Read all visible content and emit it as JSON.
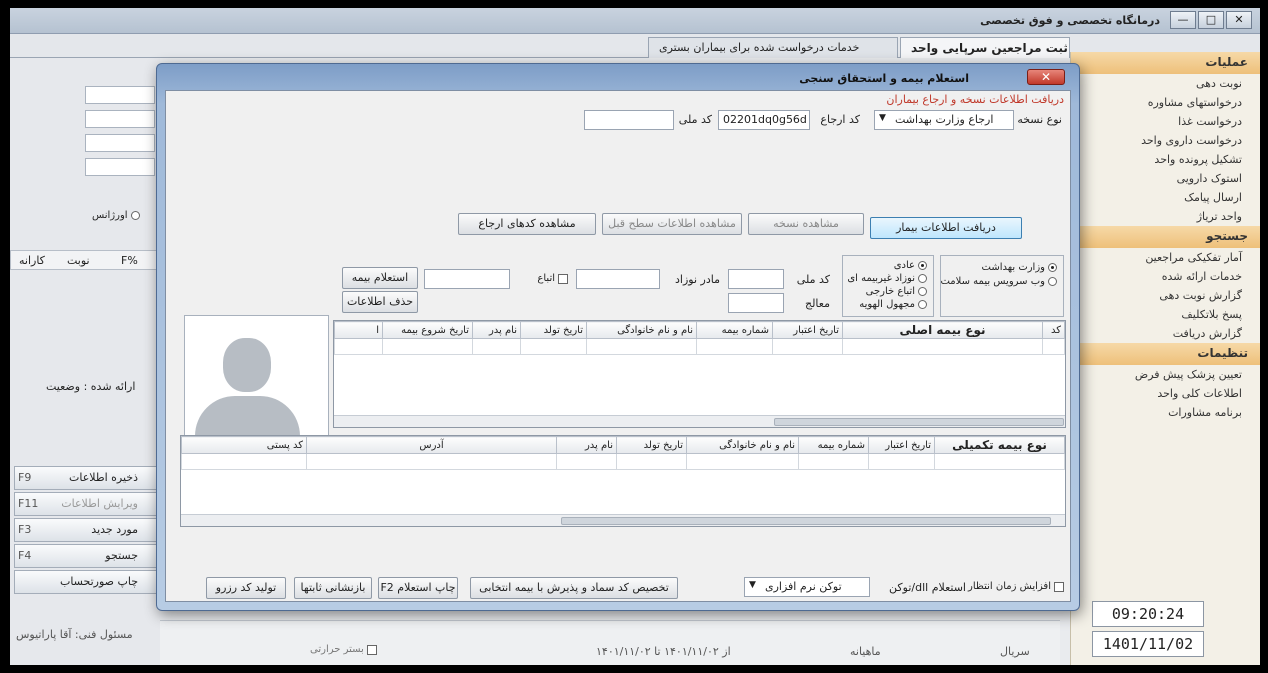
{
  "window": {
    "title": "درمانگاه تخصصی و فوق تخصصی",
    "buttons": [
      "—",
      "□",
      "✕"
    ]
  },
  "tabs": [
    {
      "label": "ثبت مراجعین سرپایی واحد",
      "active": true
    },
    {
      "label": "خدمات درخواست شده برای بیماران بستری",
      "active": false
    }
  ],
  "sidebar": {
    "sections": [
      {
        "title": "عملیات",
        "items": [
          "نوبت دهی",
          "درخواستهای مشاوره",
          "درخواست غذا",
          "درخواست داروی واحد",
          "تشکیل پرونده واحد",
          "استوک دارویی",
          "ارسال پیامک",
          "واحد تریاژ"
        ]
      },
      {
        "title": "جستجو",
        "items": [
          "آمار تفکیکی مراجعین",
          "خدمات ارائه شده",
          "گزارش نوبت دهی",
          "پسخ بلاتکلیف",
          "گزارش دریافت"
        ]
      },
      {
        "title": "تنظیمات",
        "items": [
          "تعیین پزشک پیش فرض",
          "اطلاعات کلی واحد",
          "برنامه مشاورات"
        ]
      }
    ],
    "clock": "09:20:24",
    "date": "1401/11/02"
  },
  "left_panel": {
    "emergency_label": "اورژانس",
    "status_label": "ارائه شده : وضعیت",
    "grid_headers": [
      "F%",
      "نوبت",
      "کارانه"
    ],
    "buttons": [
      {
        "key": "F9",
        "label": "ذخیره اطلاعات"
      },
      {
        "key": "F11",
        "label": "ویرایش اطلاعات"
      },
      {
        "key": "F3",
        "label": "مورد جدید"
      },
      {
        "key": "F4",
        "label": "جستجو"
      },
      {
        "key": "",
        "label": "چاپ صورتحساب"
      }
    ],
    "footer": "مسئول فنی: آقا پاراتیوس"
  },
  "bottom_bar": {
    "credit": "بستر حرارتی",
    "date_range": "از ۱۴۰۱/۱۱/۰۲ تا ۱۴۰۱/۱۱/۰۲",
    "monthly": "ماهیانه",
    "serial": "سریال"
  },
  "dialog": {
    "title": "استعلام بیمه و استحقاق سنجی",
    "close": "✕",
    "group_title": "دریافت اطلاعات نسخه و ارجاع بیماران",
    "prescription_type_label": "نوع نسخه",
    "prescription_type_value": "ارجاع وزارت بهداشت",
    "referral_code_label": "کد ارجاع",
    "referral_code_value": "02201dq0g56d",
    "national_code_label": "کد ملی",
    "buttons_row": {
      "fetch_patient": "دریافت اطلاعات بیمار",
      "view_prescription": "مشاهده نسخه",
      "view_prev_level": "مشاهده اطلاعات سطح قبل",
      "view_referral_codes": "مشاهده کدهای ارجاع"
    },
    "insurer_options": [
      {
        "label": "وزارت بهداشت",
        "checked": true
      },
      {
        "label": "وب سرویس بیمه سلامت",
        "checked": false
      }
    ],
    "patient_type_options": [
      {
        "label": "عادی",
        "checked": true
      },
      {
        "label": "نوزاد غیربیمه ای",
        "checked": false
      },
      {
        "label": "اتباع خارجی",
        "checked": false
      },
      {
        "label": "مجهول الهویه",
        "checked": false
      }
    ],
    "search": {
      "national_code_label": "کد ملی",
      "mother_of_newborn_label": "مادر نوزاد",
      "foreign_label": "اتباع",
      "doctor_label": "معالج",
      "inquiry_button": "استعلام بیمه",
      "delete_button": "حذف اطلاعات"
    },
    "main_insurance_headers": [
      "کد",
      "نوع بیمه اصلی",
      "تاریخ اعتبار",
      "شماره بیمه",
      "نام و نام خانوادگی",
      "تاریخ تولد",
      "نام پدر",
      "تاریخ شروع بیمه",
      "ا"
    ],
    "supplementary_headers": [
      "نوع بیمه تکمیلی",
      "تاریخ اعتبار",
      "شماره بیمه",
      "نام و نام خانوادگی",
      "تاریخ تولد",
      "نام پدر",
      "آدرس",
      "کد پستی"
    ],
    "footer": {
      "waiting_time_label": "افزایش زمان انتظار",
      "token_label": "توکن/dll استعلام",
      "token_value": "توکن نرم افزاری",
      "assign_button": "تخصیص کد سماد و پذیرش با بیمه انتخابی",
      "print_button": "F2 چاپ استعلام",
      "reload_button": "بازنشانی ثابتها",
      "generate_button": "تولید کد رزرو"
    }
  }
}
